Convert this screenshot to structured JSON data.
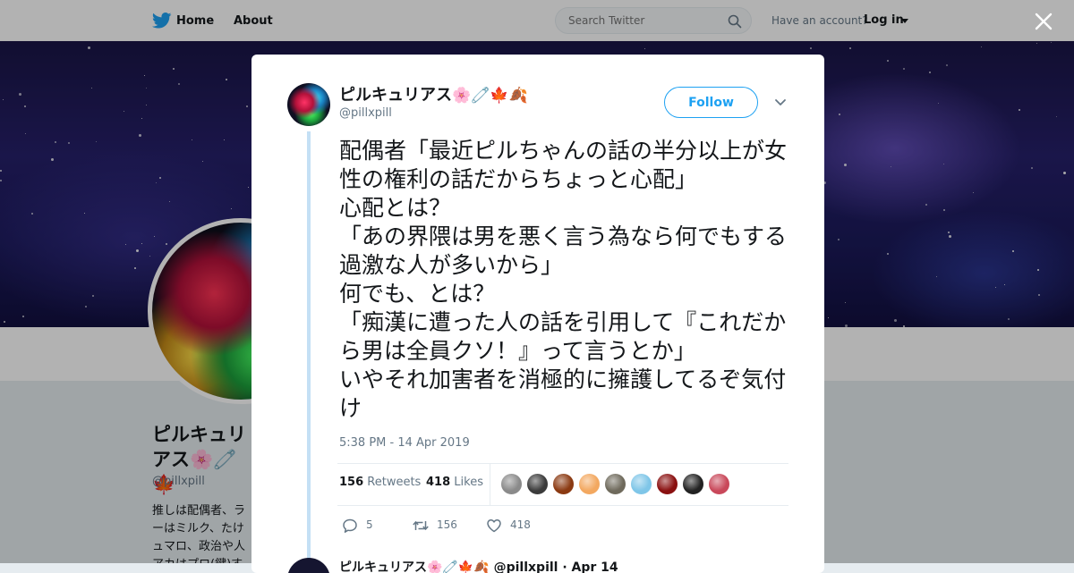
{
  "nav": {
    "home": "Home",
    "about": "About",
    "search_placeholder": "Search Twitter",
    "have_account": "Have an account?",
    "login": "Log in"
  },
  "profile_bg": {
    "name": "ピルキュリアス🌸🧷🍁",
    "handle": "@pillxpill",
    "bio": "推しは配偶者、ラ\nーはミルク、たけ\nュマロ、政治や人\nアカはプロ(鍵)す"
  },
  "tweet": {
    "author_name": "ピルキュリアス",
    "author_emoji": "🌸🧷🍁🍂",
    "handle": "@pillxpill",
    "follow_label": "Follow",
    "text": "配偶者「最近ピルちゃんの話の半分以上が女性の権利の話だからちょっと心配」\n心配とは？\n「あの界隈は男を悪く言う為なら何でもする過激な人が多いから」\n何でも、とは？\n「痴漢に遭った人の話を引用して『これだから男は全員クソ！』って言うとか」\nいやそれ加害者を消極的に擁護してるぞ気付け",
    "timestamp": "5:38 PM - 14 Apr 2019",
    "retweets_count": "156",
    "retweets_label": "Retweets",
    "likes_count": "418",
    "likes_label": "Likes",
    "reply_count": "5",
    "retweet_action_count": "156",
    "like_action_count": "418",
    "liker_colors": [
      "#8a8a8a",
      "#3b3b3b",
      "#8b3a12",
      "#f3a860",
      "#6f6a5c",
      "#7fc6e8",
      "#8a1010",
      "#222222",
      "#c9485a"
    ]
  },
  "next_tweet": {
    "preview": "ピルキュリアス🌸🧷🍁🍂 @pillxpill · Apr 14"
  }
}
